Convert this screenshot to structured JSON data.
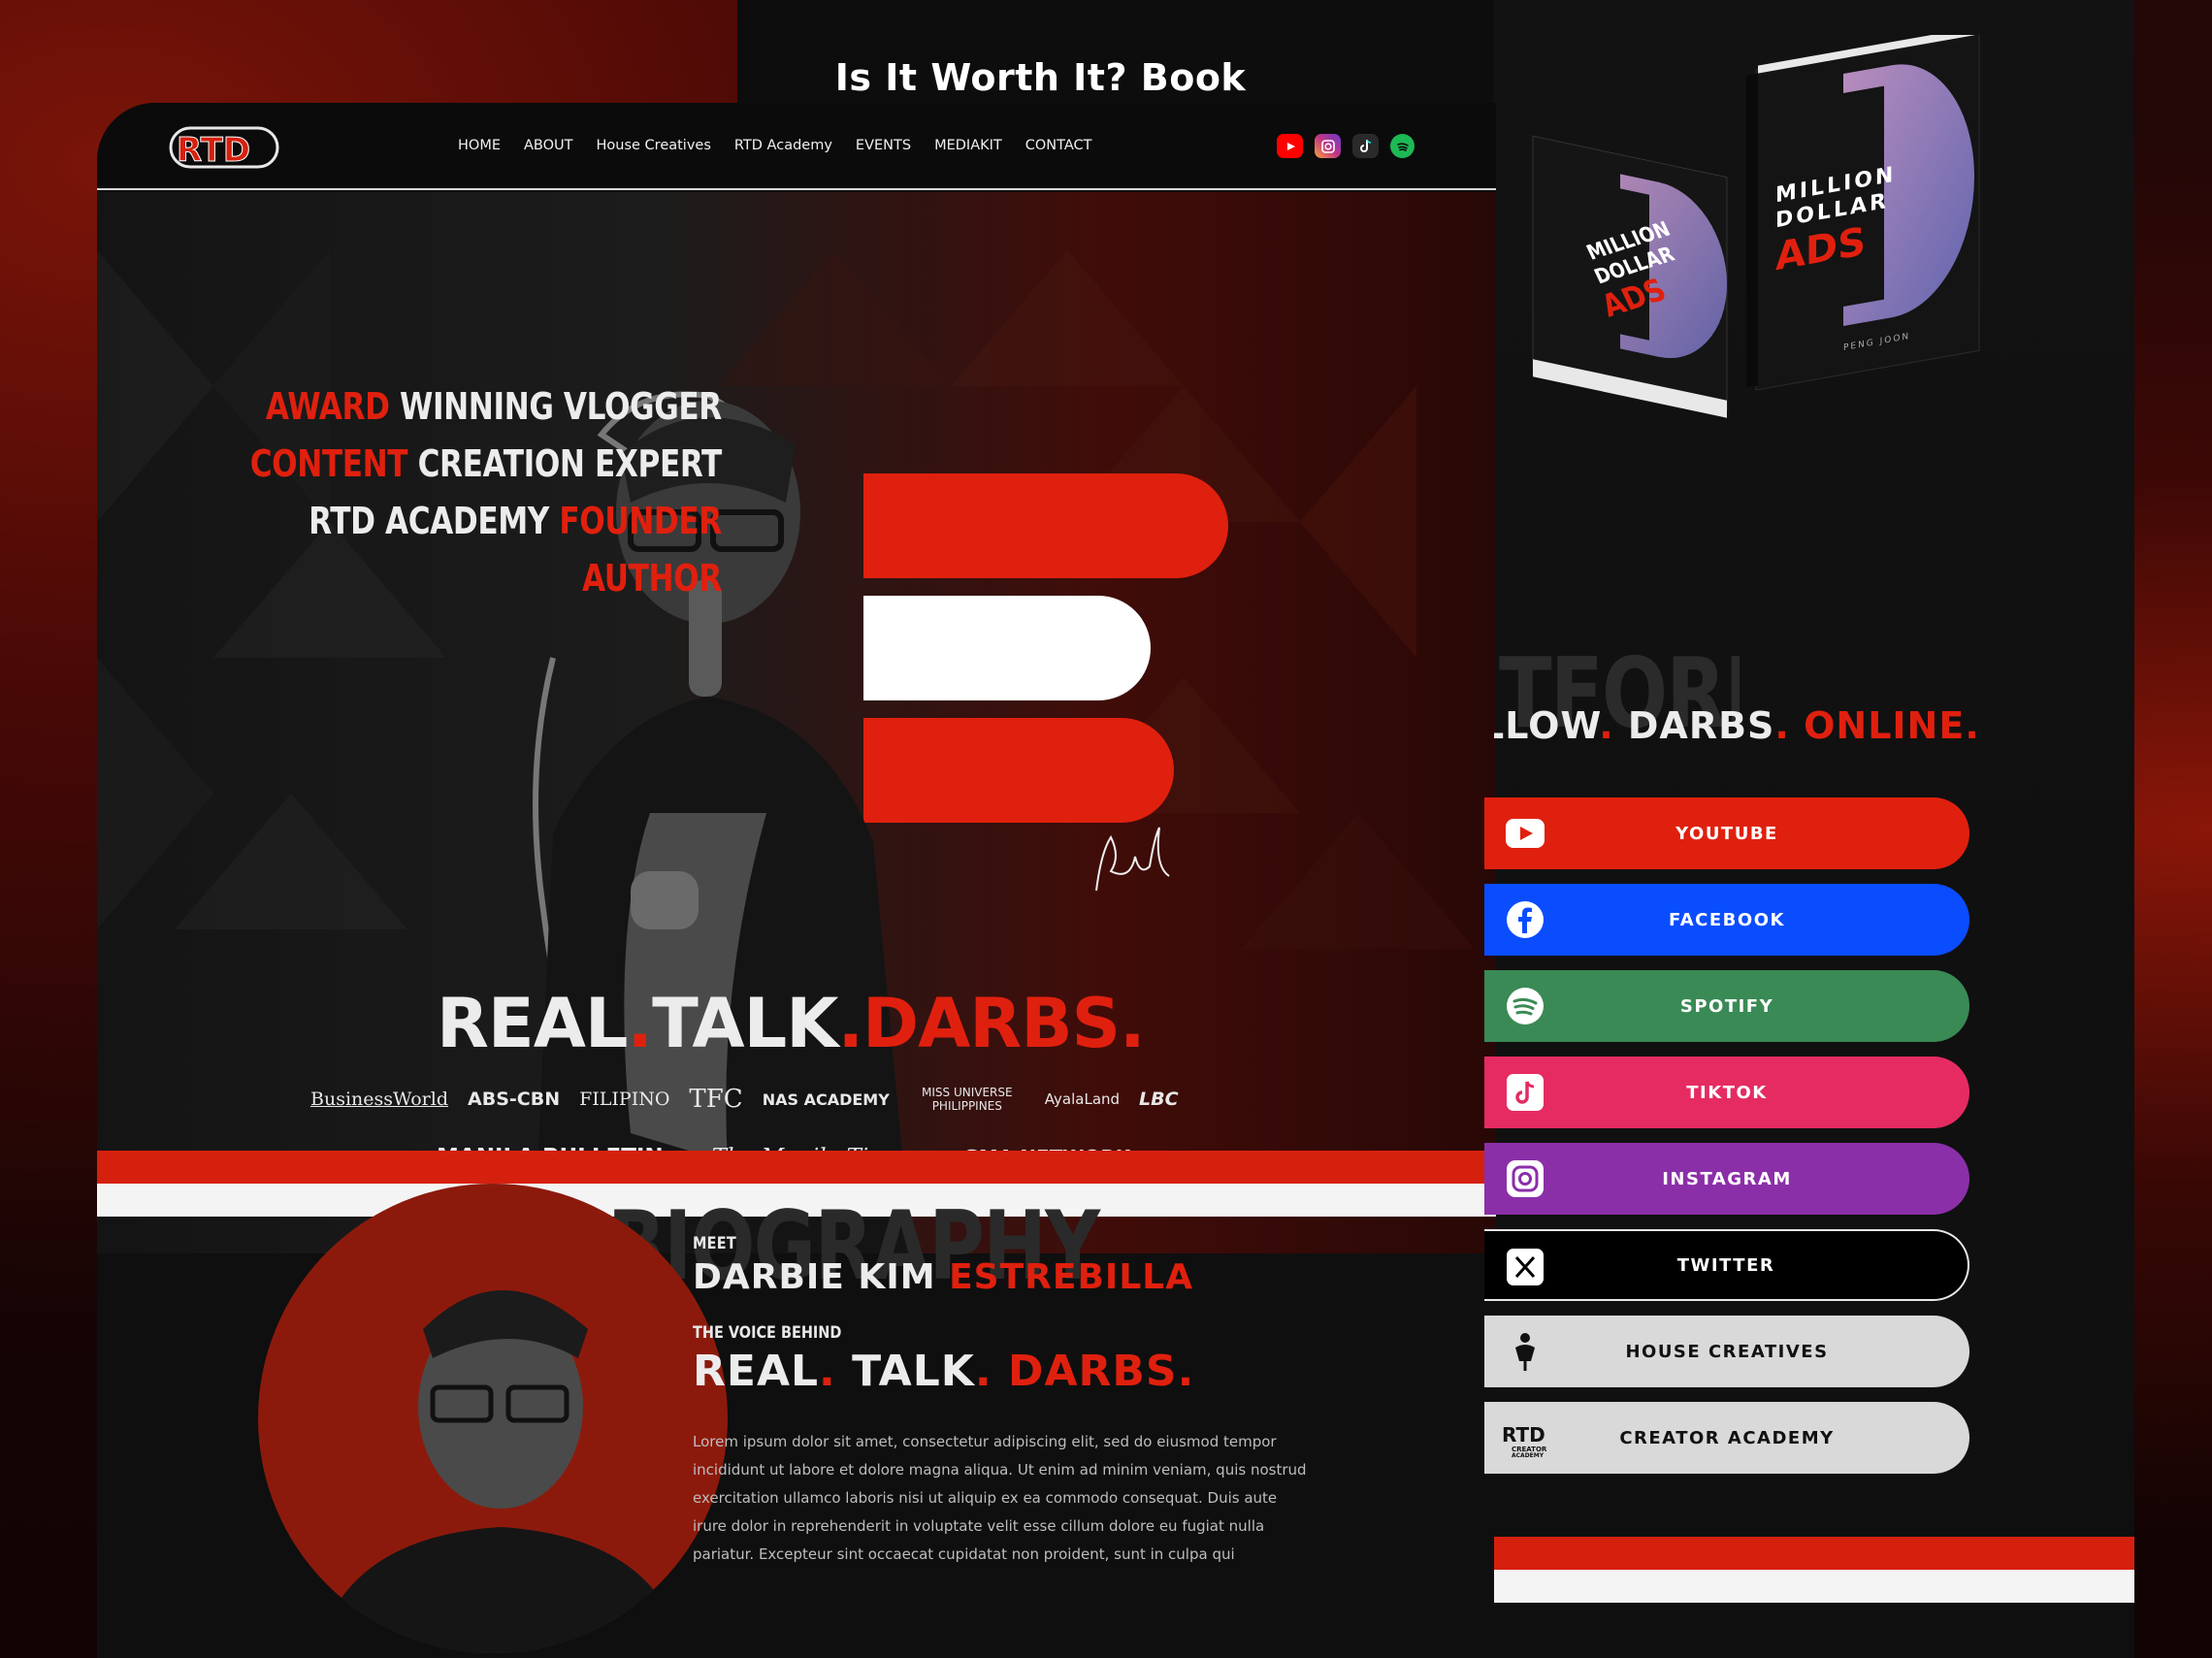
{
  "showcase": {
    "title": "Is It Worth It? Book"
  },
  "logo": {
    "text": "RTD"
  },
  "nav": {
    "items": [
      "HOME",
      "ABOUT",
      "House Creatives",
      "RTD Academy",
      "EVENTS",
      "MEDIAKIT",
      "CONTACT"
    ]
  },
  "nav_socials": [
    {
      "icon": "youtube-icon",
      "color": "#ff0000"
    },
    {
      "icon": "instagram-icon",
      "color": "#c13584"
    },
    {
      "icon": "tiktok-icon",
      "color": "#222222"
    },
    {
      "icon": "spotify-icon",
      "color": "#1db954"
    }
  ],
  "hero": {
    "taglines": [
      {
        "a": "AWARD",
        "b": "WINNING VLOGGER"
      },
      {
        "a": "CONTENT",
        "b": "CREATION EXPERT"
      },
      {
        "a": "RTD ACADEMY",
        "b": "FOUNDER"
      },
      {
        "a": "",
        "b": "AUTHOR"
      }
    ],
    "big_tagline": {
      "real": "REAL",
      "dot1": ".",
      "talk": "TALK",
      "dot2": ".",
      "darbs": "DARBS."
    },
    "signature": "Rtd",
    "media_row1": [
      "BusinessWorld",
      "ABS-CBN",
      "FILIPINO",
      "TFC",
      "NAS ACADEMY",
      "MISS UNIVERSE PHILIPPINES",
      "AyalaLand",
      "LBC"
    ],
    "media_row2": [
      "MANILA BULLETIN",
      "The Manila Times",
      "GMA NETWORK"
    ]
  },
  "biography": {
    "bg_word": "BIOGRAPHY",
    "meet": "MEET",
    "name_first": "DARBIE KIM",
    "name_last": "ESTREBILLA",
    "voice": "THE VOICE BEHIND",
    "rtd_real": "REAL",
    "rtd_talk": "TALK",
    "rtd_darbs": "DARBS.",
    "text": "Lorem ipsum dolor sit amet, consectetur adipiscing elit, sed do eiusmod tempor incididunt ut labore et dolore magna aliqua. Ut enim ad minim veniam, quis nostrud exercitation ullamco laboris nisi ut aliquip ex ea commodo consequat. Duis aute irure dolor in reprehenderit in voluptate velit esse cillum dolore eu fugiat nulla pariatur. Excepteur sint occaecat cupidatat non proident, sunt in culpa qui"
  },
  "book": {
    "title_line1": "MILLION",
    "title_line2": "DOLLAR",
    "title_line3": "ADS",
    "author": "PENG JOON"
  },
  "platforms": {
    "bg_word": "TFORMS",
    "follow_a": "LLOW",
    "follow_b": "DARBS",
    "follow_c": "ONLINE.",
    "links": [
      {
        "label": "YOUTUBE",
        "icon": "youtube-icon",
        "bg": "#e0200e",
        "fg": "#ffffff"
      },
      {
        "label": "FACEBOOK",
        "icon": "facebook-icon",
        "bg": "#0a4dff",
        "fg": "#ffffff"
      },
      {
        "label": "SPOTIFY",
        "icon": "spotify-icon",
        "bg": "#3a8a55",
        "fg": "#ffffff"
      },
      {
        "label": "TIKTOK",
        "icon": "tiktok-icon",
        "bg": "#e52b62",
        "fg": "#ffffff"
      },
      {
        "label": "INSTAGRAM",
        "icon": "instagram-icon",
        "bg": "#8b2fa8",
        "fg": "#ffffff"
      },
      {
        "label": "TWITTER",
        "icon": "x-icon",
        "bg": "#000000",
        "fg": "#ffffff"
      },
      {
        "label": "HOUSE CREATIVES",
        "icon": "house-creatives-icon",
        "bg": "#d9d9d9",
        "fg": "#111111"
      },
      {
        "label": "CREATOR ACADEMY",
        "icon": "rtd-academy-icon",
        "bg": "#d9d9d9",
        "fg": "#111111"
      }
    ]
  },
  "colors": {
    "accent": "#e0200e",
    "bg": "#0f0f0f"
  }
}
